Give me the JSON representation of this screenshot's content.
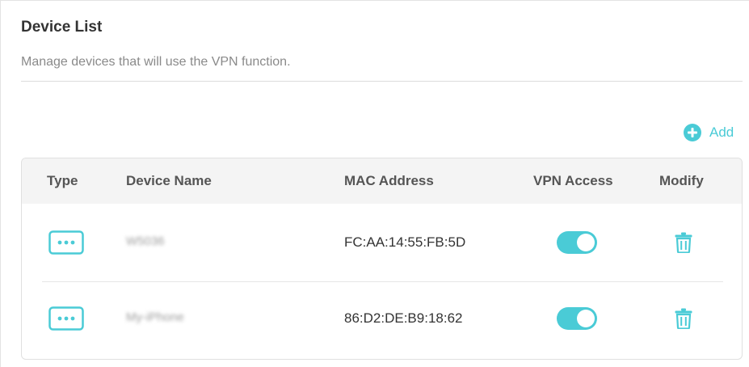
{
  "section": {
    "title": "Device List",
    "subtitle": "Manage devices that will use the VPN function."
  },
  "toolbar": {
    "add_label": "Add",
    "add_icon": "plus-circle-icon"
  },
  "table": {
    "columns": [
      "Type",
      "Device Name",
      "MAC Address",
      "VPN Access",
      "Modify"
    ],
    "rows": [
      {
        "type_icon": "other-device-icon",
        "device_name": "W5036",
        "mac": "FC:AA:14:55:FB:5D",
        "vpn_access": true,
        "modify_icon": "trash-icon"
      },
      {
        "type_icon": "other-device-icon",
        "device_name": "My-iPhone",
        "mac": "86:D2:DE:B9:18:62",
        "vpn_access": true,
        "modify_icon": "trash-icon"
      }
    ]
  },
  "colors": {
    "accent": "#4acbd6",
    "header_bg": "#f4f4f4",
    "text_dark": "#333333",
    "text_muted": "#8a8a8a"
  }
}
